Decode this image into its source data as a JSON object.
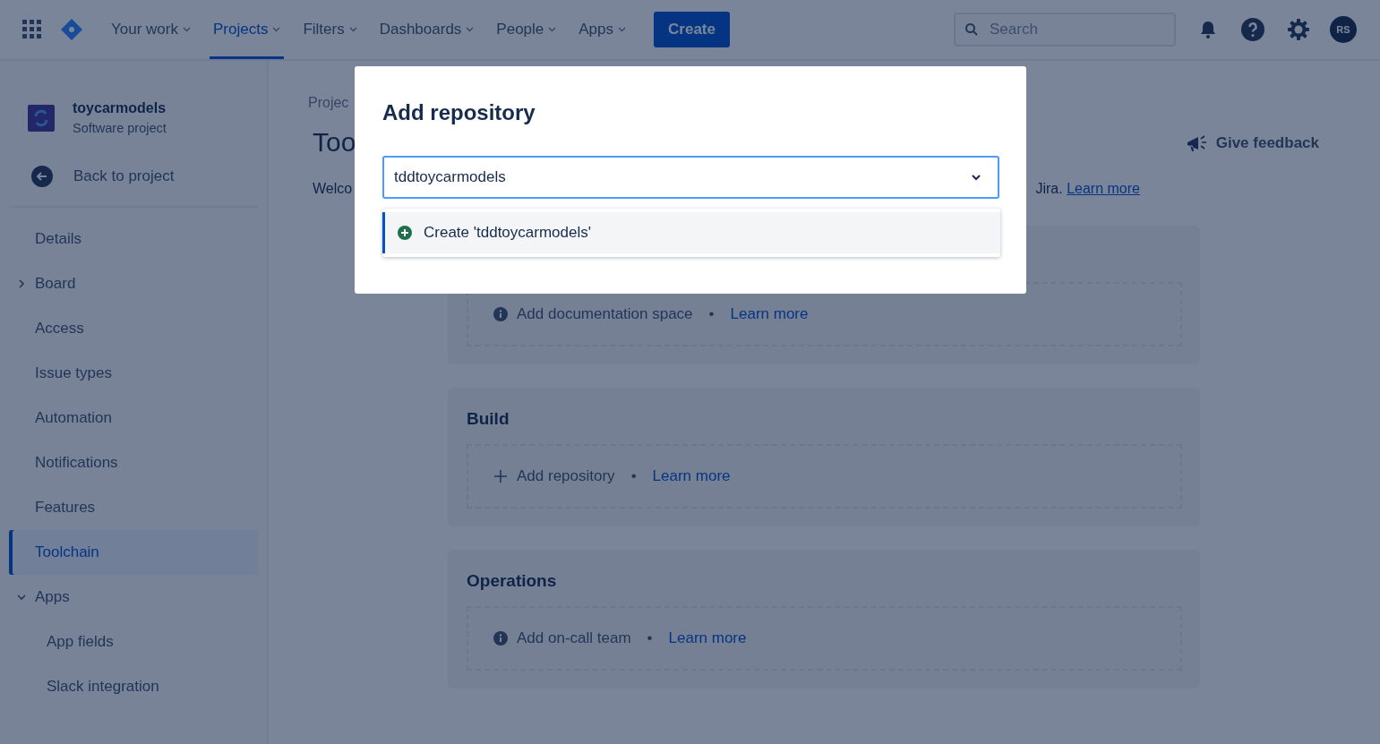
{
  "top_nav": {
    "items": [
      {
        "label": "Your work",
        "selected": false
      },
      {
        "label": "Projects",
        "selected": true
      },
      {
        "label": "Filters",
        "selected": false
      },
      {
        "label": "Dashboards",
        "selected": false
      },
      {
        "label": "People",
        "selected": false
      },
      {
        "label": "Apps",
        "selected": false
      }
    ],
    "create_button": "Create",
    "search": {
      "placeholder": "Search"
    },
    "avatar": "RS"
  },
  "sidebar": {
    "project": {
      "name": "toycarmodels",
      "type": "Software project"
    },
    "back_link": "Back to project",
    "items": [
      {
        "kind": "link",
        "label": "Details",
        "selected": false
      },
      {
        "kind": "group",
        "label": "Board",
        "selected": false,
        "expanded": false
      },
      {
        "kind": "link",
        "label": "Access",
        "selected": false
      },
      {
        "kind": "link",
        "label": "Issue types",
        "selected": false
      },
      {
        "kind": "link",
        "label": "Automation",
        "selected": false
      },
      {
        "kind": "link",
        "label": "Notifications",
        "selected": false
      },
      {
        "kind": "link",
        "label": "Features",
        "selected": false
      },
      {
        "kind": "link",
        "label": "Toolchain",
        "selected": true
      },
      {
        "kind": "group",
        "label": "Apps",
        "selected": false,
        "expanded": true,
        "children": [
          {
            "label": "App fields",
            "selected": false
          },
          {
            "label": "Slack integration",
            "selected": false
          }
        ]
      }
    ]
  },
  "main": {
    "breadcrumb": "Projec",
    "title": "Too",
    "welcome": {
      "start": "Welco",
      "end": "Jira.",
      "link": "Learn more"
    },
    "feedback": "Give feedback",
    "sections": [
      {
        "action": {
          "kind": "info",
          "label": "Add documentation space",
          "separator": "•",
          "link": "Learn more"
        }
      },
      {
        "title": "Build",
        "action": {
          "kind": "add",
          "label": "Add repository",
          "separator": "•",
          "link": "Learn more"
        }
      },
      {
        "title": "Operations",
        "action": {
          "kind": "info",
          "label": "Add on-call team",
          "separator": "•",
          "link": "Learn more"
        }
      }
    ]
  },
  "modal": {
    "title": "Add repository",
    "field_value": "tddtoycarmodels",
    "options": [
      {
        "label": "Create 'tddtoycarmodels'",
        "selected": true
      }
    ]
  }
}
